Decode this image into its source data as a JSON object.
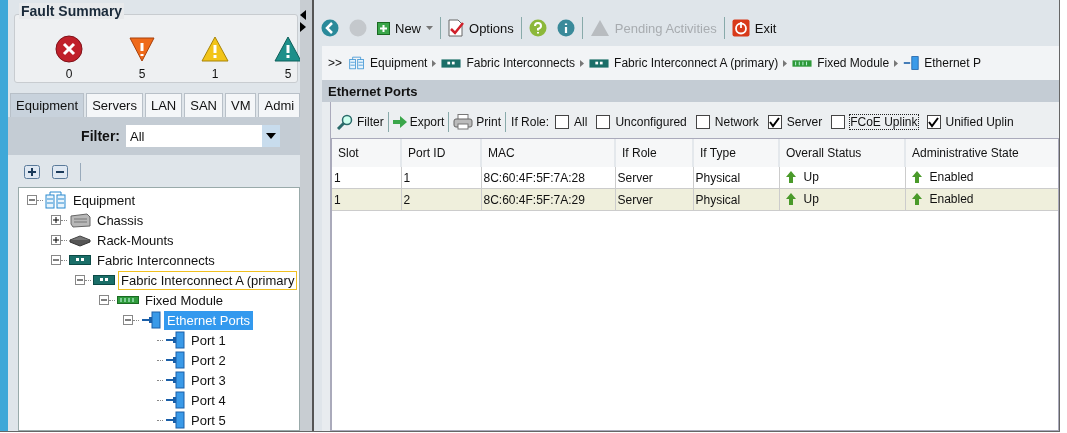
{
  "fault_summary": {
    "title": "Fault Summary",
    "items": [
      {
        "kind": "critical",
        "count": "0"
      },
      {
        "kind": "major",
        "count": "5"
      },
      {
        "kind": "minor",
        "count": "1"
      },
      {
        "kind": "warning",
        "count": "5"
      }
    ]
  },
  "nav_tabs": [
    {
      "label": "Equipment",
      "selected": true
    },
    {
      "label": "Servers",
      "selected": false
    },
    {
      "label": "LAN",
      "selected": false
    },
    {
      "label": "SAN",
      "selected": false
    },
    {
      "label": "VM",
      "selected": false
    },
    {
      "label": "Admi",
      "selected": false
    }
  ],
  "filter": {
    "label": "Filter:",
    "value": "All"
  },
  "tree": [
    {
      "label": "Equipment",
      "kind": "equipment",
      "expanded": true,
      "selected": false,
      "focused": false,
      "children": [
        {
          "label": "Chassis",
          "kind": "chassis",
          "expanded": false,
          "selected": false,
          "focused": false
        },
        {
          "label": "Rack-Mounts",
          "kind": "rack",
          "expanded": false,
          "selected": false,
          "focused": false
        },
        {
          "label": "Fabric Interconnects",
          "kind": "fabric",
          "expanded": true,
          "selected": false,
          "focused": false,
          "children": [
            {
              "label": "Fabric Interconnect A (primary",
              "kind": "fabric",
              "expanded": true,
              "selected": false,
              "focused": true,
              "children": [
                {
                  "label": "Fixed Module",
                  "kind": "module",
                  "expanded": true,
                  "selected": false,
                  "focused": false,
                  "children": [
                    {
                      "label": "Ethernet Ports",
                      "kind": "port",
                      "expanded": true,
                      "selected": true,
                      "focused": false,
                      "children": [
                        {
                          "label": "Port 1",
                          "kind": "port",
                          "selected": false,
                          "focused": false
                        },
                        {
                          "label": "Port 2",
                          "kind": "port",
                          "selected": false,
                          "focused": false
                        },
                        {
                          "label": "Port 3",
                          "kind": "port",
                          "selected": false,
                          "focused": false
                        },
                        {
                          "label": "Port 4",
                          "kind": "port",
                          "selected": false,
                          "focused": false
                        },
                        {
                          "label": "Port 5",
                          "kind": "port",
                          "selected": false,
                          "focused": false
                        }
                      ]
                    }
                  ]
                }
              ]
            }
          ]
        }
      ]
    }
  ],
  "toolbar": [
    {
      "kind": "back",
      "disabled": false
    },
    {
      "kind": "forward",
      "disabled": true
    },
    {
      "kind": "new",
      "label": "New",
      "disabled": false
    },
    {
      "kind": "options",
      "label": "Options",
      "disabled": false
    },
    {
      "kind": "help"
    },
    {
      "kind": "info"
    },
    {
      "kind": "pending",
      "label": "Pending Activities",
      "disabled": true
    },
    {
      "kind": "exit",
      "label": "Exit",
      "disabled": false
    }
  ],
  "breadcrumb": {
    "prefix": ">>",
    "items": [
      {
        "label": "Equipment",
        "kind": "equipment"
      },
      {
        "label": "Fabric Interconnects",
        "kind": "fabric"
      },
      {
        "label": "Fabric Interconnect A (primary)",
        "kind": "fabric"
      },
      {
        "label": "Fixed Module",
        "kind": "module"
      },
      {
        "label": "Ethernet P",
        "kind": "port"
      }
    ]
  },
  "panel_title": "Ethernet Ports",
  "table_actions": [
    {
      "label": "Filter",
      "kind": "filter"
    },
    {
      "label": "Export",
      "kind": "export"
    },
    {
      "label": "Print",
      "kind": "print"
    }
  ],
  "role_filter": {
    "label": "If Role:",
    "options": [
      {
        "label": "All",
        "checked": false,
        "focused": false
      },
      {
        "label": "Unconfigured",
        "checked": false,
        "focused": false
      },
      {
        "label": "Network",
        "checked": false,
        "focused": false
      },
      {
        "label": "Server",
        "checked": true,
        "focused": false
      },
      {
        "label": "FCoE Uplink",
        "checked": false,
        "focused": true
      },
      {
        "label": "Unified Uplin",
        "checked": true,
        "focused": false
      }
    ]
  },
  "table": {
    "columns": [
      {
        "label": "Slot",
        "kind": "text"
      },
      {
        "label": "Port ID",
        "kind": "text"
      },
      {
        "label": "MAC",
        "kind": "text"
      },
      {
        "label": "If Role",
        "kind": "text"
      },
      {
        "label": "If Type",
        "kind": "text"
      },
      {
        "label": "Overall Status",
        "kind": "status"
      },
      {
        "label": "Administrative State",
        "kind": "status"
      }
    ],
    "rows": [
      {
        "selected": false,
        "cells": [
          "1",
          "1",
          "8C:60:4F:5F:7A:28",
          "Server",
          "Physical",
          "Up",
          "Enabled"
        ]
      },
      {
        "selected": true,
        "cells": [
          "1",
          "2",
          "8C:60:4F:5F:7A:29",
          "Server",
          "Physical",
          "Up",
          "Enabled"
        ]
      }
    ]
  }
}
